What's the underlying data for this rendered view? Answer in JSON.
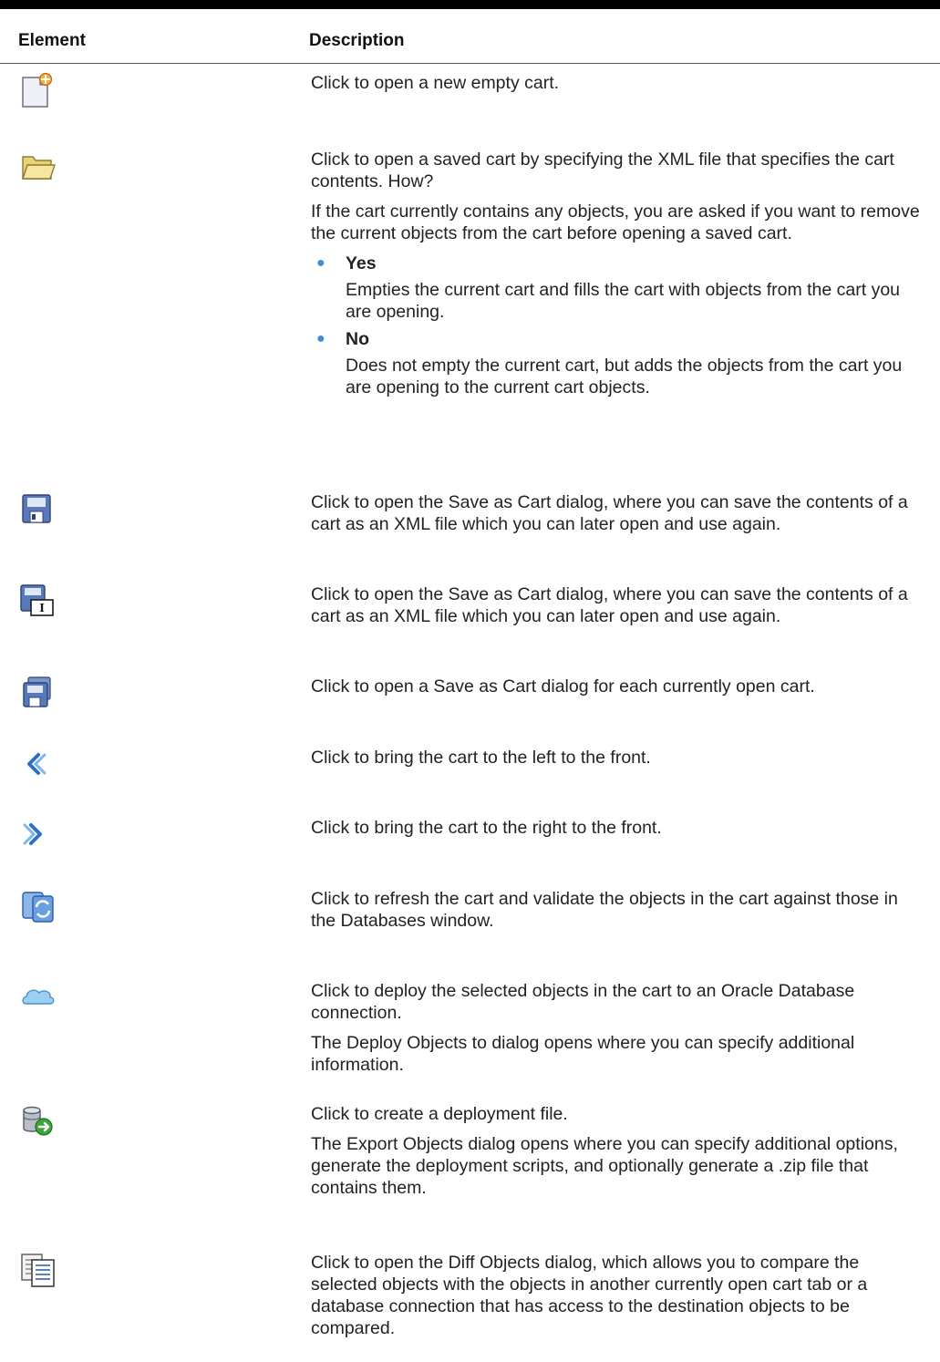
{
  "table": {
    "header_element": "Element",
    "header_description": "Description",
    "rows": [
      {
        "icon": "new-cart-icon",
        "paragraphs": [
          "Click to open a new empty cart."
        ]
      },
      {
        "icon": "open-folder-icon",
        "paragraphs": [
          "Click to open a saved cart by specifying the XML file that specifies the cart contents. How?",
          "If the cart currently contains any objects, you are asked if you want to remove the current objects from the cart before opening a saved cart."
        ],
        "options": [
          {
            "term": "Yes",
            "text": "Empties the current cart and fills the cart with objects from the cart you are opening."
          },
          {
            "term": "No",
            "text": "Does not empty the current cart, but adds the objects from the cart you are opening to the current cart objects."
          }
        ]
      },
      {
        "icon": "save-icon",
        "paragraphs": [
          "Click to open the Save as Cart dialog, where you can save the contents of a cart as an XML file which you can later open and use again."
        ]
      },
      {
        "icon": "save-as-icon",
        "paragraphs": [
          "Click to open the Save as Cart dialog, where you can save the contents of a cart as an XML file which you can later open and use again."
        ]
      },
      {
        "icon": "save-all-icon",
        "paragraphs": [
          "Click to open a Save as Cart dialog for each currently open cart."
        ]
      },
      {
        "icon": "chevron-left-icon",
        "paragraphs": [
          "Click to bring the cart to the left to the front."
        ]
      },
      {
        "icon": "chevron-right-icon",
        "paragraphs": [
          "Click to bring the cart to the right to the front."
        ]
      },
      {
        "icon": "refresh-icon",
        "paragraphs": [
          "Click to refresh the cart and validate the objects in the cart against those in the Databases window."
        ]
      },
      {
        "icon": "cloud-deploy-icon",
        "paragraphs": [
          "Click to deploy the selected objects in the cart to an Oracle Database connection.",
          "The Deploy Objects to dialog opens where you can specify additional information."
        ]
      },
      {
        "icon": "database-export-icon",
        "paragraphs": [
          "Click to create a deployment file.",
          "The Export Objects dialog opens where you can specify additional options, generate the deployment scripts, and optionally generate a .zip file that contains them."
        ]
      },
      {
        "icon": "diff-objects-icon",
        "paragraphs": [
          "Click to open the Diff Objects dialog, which allows you to compare the selected objects with the objects in another currently open cart tab or a database connection that has access to the destination objects to be compared."
        ]
      }
    ]
  }
}
